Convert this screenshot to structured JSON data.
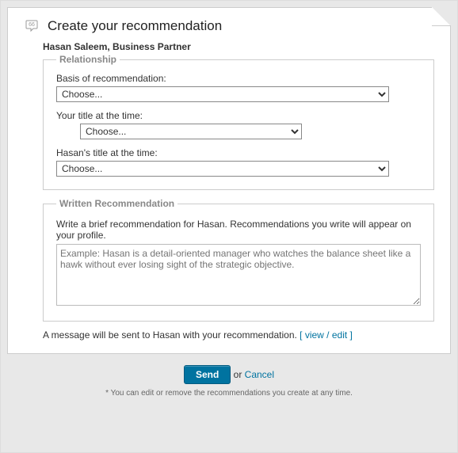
{
  "header": {
    "title": "Create your recommendation"
  },
  "subject": "Hasan Saleem, Business Partner",
  "relationship": {
    "legend": "Relationship",
    "basis_label": "Basis of recommendation:",
    "basis_value": "Choose...",
    "your_title_label": "Your title at the time:",
    "your_title_value": "Choose...",
    "their_title_label": "Hasan's title at the time:",
    "their_title_value": "Choose..."
  },
  "written": {
    "legend": "Written Recommendation",
    "help": "Write a brief recommendation for Hasan. Recommendations you write will appear on your profile.",
    "placeholder": "Example: Hasan is a detail-oriented manager who watches the balance sheet like a hawk without ever losing sight of the strategic objective."
  },
  "message_notice": "A message will be sent to Hasan with your recommendation. ",
  "view_edit": "view / edit",
  "actions": {
    "send": "Send",
    "or": " or ",
    "cancel": "Cancel"
  },
  "footnote": "* You can edit or remove the recommendations you create at any time."
}
